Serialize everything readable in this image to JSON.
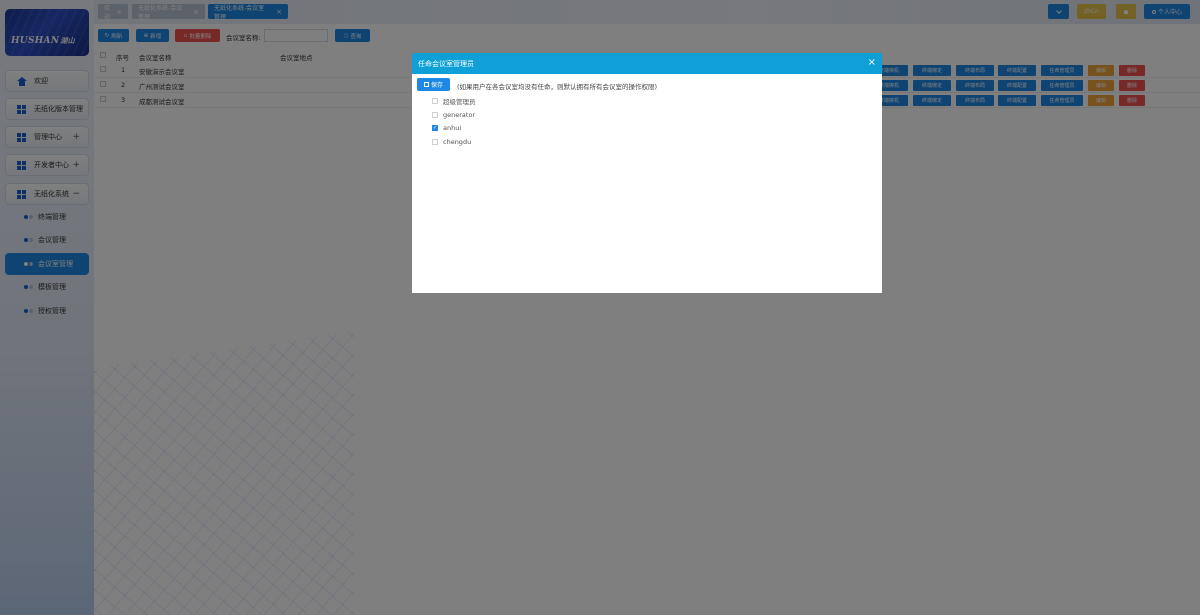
{
  "logo": {
    "brand": "HUSHAN",
    "brand_suffix": "湖山"
  },
  "sidebar": {
    "items": [
      {
        "label": "欢迎",
        "icon": "home-icon"
      },
      {
        "label": "无纸化版本管理",
        "icon": "grid-icon"
      },
      {
        "label": "管理中心",
        "icon": "grid-icon",
        "expander": "+"
      },
      {
        "label": "开发者中心",
        "icon": "grid-icon",
        "expander": "+"
      },
      {
        "label": "无纸化系统",
        "icon": "grid-icon",
        "expander": "−"
      }
    ],
    "sub_items": [
      {
        "label": "终端管理"
      },
      {
        "label": "会议管理"
      },
      {
        "label": "会议室管理",
        "active": true
      },
      {
        "label": "模板管理"
      },
      {
        "label": "授权管理"
      }
    ]
  },
  "tabs": [
    {
      "label": "欢迎",
      "close": "×"
    },
    {
      "label": "无纸化系统-会议管理",
      "close": "×"
    },
    {
      "label": "无纸化系统-会议室管理",
      "close": "×",
      "active": true
    }
  ],
  "topbar": {
    "dropdown_icon": "chevron-down-icon",
    "lang_label": "zhCn",
    "bell_icon": "bell-icon",
    "profile_label": "个人中心"
  },
  "toolbar": {
    "refresh_label": "刷新",
    "add_label": "新增",
    "batch_delete_label": "批量删除",
    "search_label": "会议室名称:",
    "search_value": "",
    "query_label": "查询"
  },
  "table": {
    "headers": {
      "index": "序号",
      "name": "会议室名称",
      "location": "会议室地点"
    },
    "rows": [
      {
        "index": "1",
        "name": "安徽演示会议室",
        "location": ""
      },
      {
        "index": "2",
        "name": "广州测试会议室",
        "location": ""
      },
      {
        "index": "3",
        "name": "成都测试会议室",
        "location": ""
      }
    ],
    "actions": [
      "终端绑机",
      "终端绑定",
      "终端布局",
      "终端配置",
      "任命管理员",
      "编辑",
      "删除"
    ]
  },
  "modal": {
    "title": "任命会议室管理员",
    "close": "×",
    "save_label": "保存",
    "hint": "(如果用户在各会议室均没有任命，则默认拥有所有会议室的操作权限)",
    "options": [
      {
        "label": "超级管理员",
        "checked": false
      },
      {
        "label": "generator",
        "checked": false
      },
      {
        "label": "anhui",
        "checked": true
      },
      {
        "label": "chengdu",
        "checked": false
      }
    ],
    "check_mark": "✓"
  },
  "colors": {
    "primary": "#1e88e5",
    "modal_header": "#0ea0d6",
    "danger": "#ef5350",
    "warning": "#f0a43a",
    "lang_badge": "#e8c34a"
  }
}
